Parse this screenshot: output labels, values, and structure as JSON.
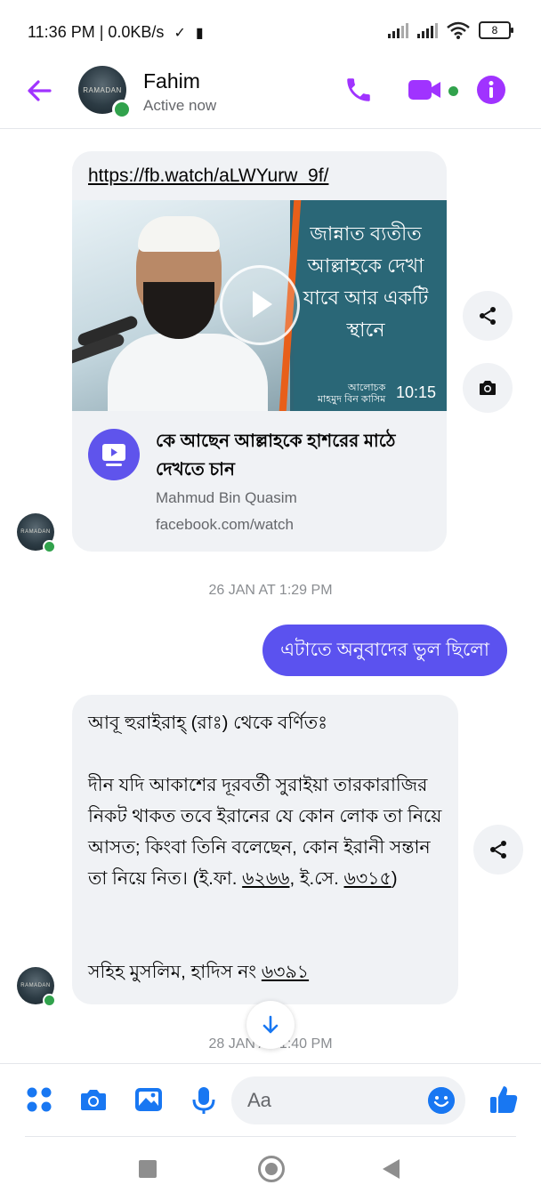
{
  "status_bar": {
    "time_net": "11:36 PM | 0.0KB/s",
    "battery": "8"
  },
  "header": {
    "contact_name": "Fahim",
    "status": "Active now",
    "avatar_text": "RAMADAN",
    "colors": {
      "accent": "#a033ff",
      "online": "#31a24c"
    }
  },
  "messages": {
    "link_card": {
      "url": "https://fb.watch/aLWYurw_9f/",
      "thumbnail_text": "জান্নাত ব্যতীত আল্লাহকে দেখা যাবে আর একটি স্থানে",
      "thumbnail_speaker": "আলোচক\nমাহমুদ বিন কাসিম",
      "duration": "10:15",
      "title": "কে আছেন আল্লাহকে হাশরের মাঠে দেখতে চান",
      "author": "Mahmud Bin Quasim",
      "domain": "facebook.com/watch"
    },
    "timestamp_1": "26 JAN AT 1:29 PM",
    "outgoing_text": "এটাতে অনুবাদের ভুল ছিলো",
    "incoming_text": {
      "line1": "আবূ হুরাইরাহ্ (রাঃ) থেকে বর্ণিতঃ",
      "para2_a": "দীন যদি আকাশের দূরবর্তী সুরাইয়া তারকারাজির নিকট থাকত তবে ইরানের যে কোন লোক তা নিয়ে আসত; কিংবা তিনি বলেছেন, কোন ইরানী সন্তান তা নিয়ে নিত। (ই.ফা. ",
      "ref1": "৬২৬৬",
      "para2_b": ", ই.সে. ",
      "ref2": "৬৩১৫",
      "para2_c": ")",
      "source_prefix": "সহিহ মুসলিম, হাদিস নং ",
      "source_ref": "৬৩৯১"
    },
    "timestamp_2": "28 JAN AT 1:40 PM"
  },
  "composer": {
    "placeholder": "Aa",
    "colors": {
      "icon_blue": "#1877f2",
      "bubble_out": "#5b52ef"
    }
  }
}
